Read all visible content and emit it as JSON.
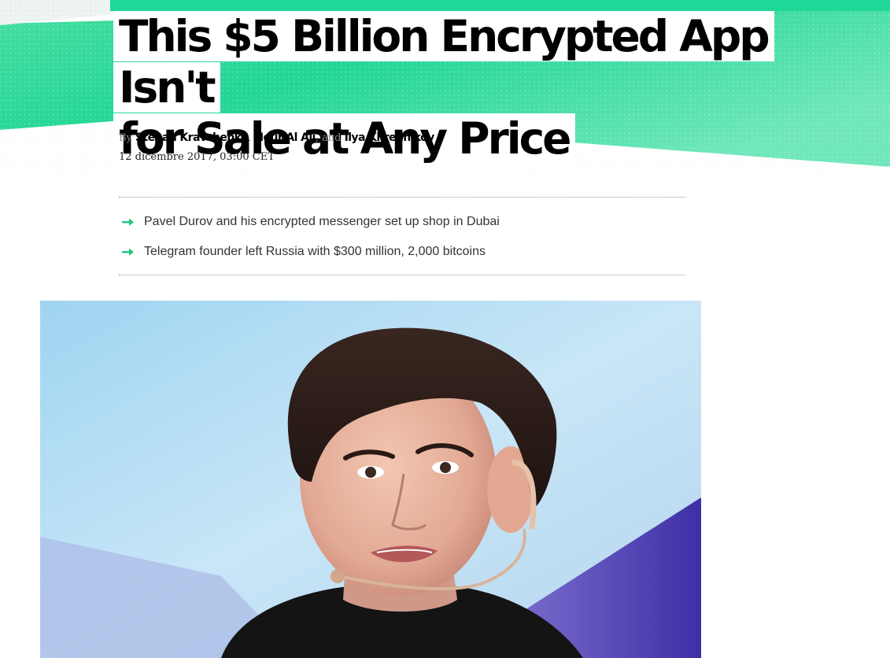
{
  "article": {
    "headline_line1": "This $5 Billion Encrypted App Isn't",
    "headline_line2": "for Sale at Any Price",
    "byline": {
      "by_label": "By",
      "authors": [
        "Stepan Kravchenko",
        "Nour Al Ali",
        "Ilya Khrennikov"
      ],
      "separator": ",",
      "and_label": ", and"
    },
    "dateline": "12 dicembre 2017, 03:00 CET",
    "abstract": [
      "Pavel Durov and his encrypted messenger set up shop in Dubai",
      "Telegram founder left Russia with $300 million, 2,000 bitcoins"
    ],
    "lede_image": {
      "icon": "photo-of-man-with-headset-microphone"
    }
  },
  "colors": {
    "accent_green": "#1dd596",
    "accent_green_light": "#7fe8c0",
    "arrow_green": "#22c47a",
    "headline_text": "#000000",
    "rule_gray": "#9a9a9a"
  },
  "icons": {
    "abstract_bullet": "right-arrow-icon"
  }
}
